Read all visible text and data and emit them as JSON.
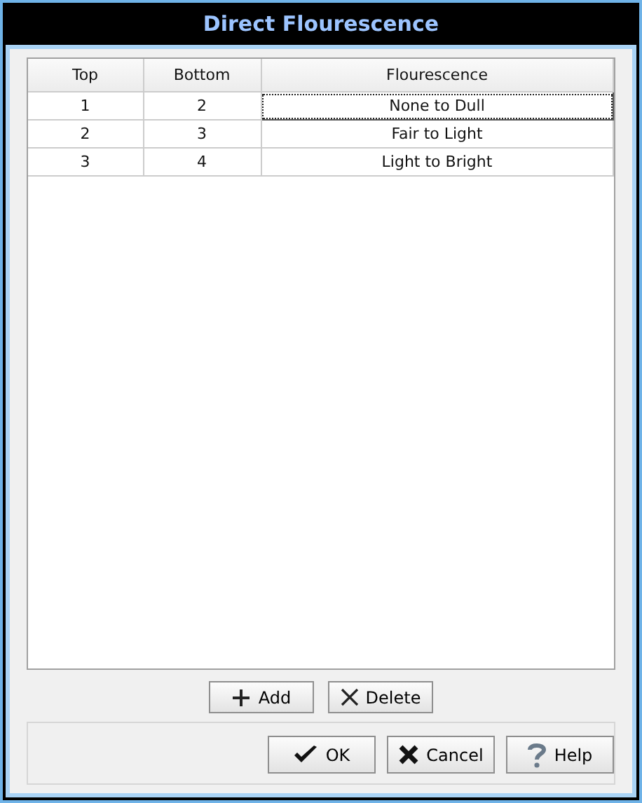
{
  "window": {
    "title": "Direct Flourescence"
  },
  "table": {
    "columns": [
      "Top",
      "Bottom",
      "Flourescence"
    ],
    "rows": [
      {
        "cells": [
          "1",
          "2",
          "None to Dull"
        ],
        "selected": true
      },
      {
        "cells": [
          "2",
          "3",
          "Fair to Light"
        ],
        "selected": false
      },
      {
        "cells": [
          "3",
          "4",
          "Light to Bright"
        ],
        "selected": false
      }
    ]
  },
  "row_buttons": [
    {
      "kind": "add",
      "label": "Add"
    },
    {
      "kind": "delete",
      "label": "Delete"
    }
  ],
  "dialog_buttons": [
    {
      "kind": "ok",
      "label": "OK"
    },
    {
      "kind": "cancel",
      "label": "Cancel"
    },
    {
      "kind": "help",
      "label": "Help"
    }
  ]
}
